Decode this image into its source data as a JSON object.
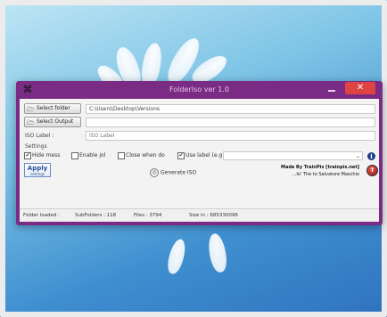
{
  "window": {
    "title": "FolderIso ver 1.0",
    "close_symbol": "✕"
  },
  "buttons": {
    "select_folder": "Select folder",
    "select_output": "Select Output"
  },
  "fields": {
    "folder_path": "C:\\Users\\Desktop\\Versions",
    "output_path": "",
    "iso_label_label": "ISO Label :",
    "iso_label_placeholder": "ISO Label"
  },
  "settings": {
    "heading": "Settings",
    "hide_msg": {
      "label": "Hide mess",
      "checked": true
    },
    "enable_jol": {
      "label": "Enable jol",
      "checked": false
    },
    "close_when_done": {
      "label": "Close when do",
      "checked": false
    },
    "use_label": {
      "label": "Use label (e.g",
      "checked": true
    },
    "label_select_value": ""
  },
  "actions": {
    "apply_label": "Apply",
    "apply_sub": "settings",
    "generate_label": "Generate ISO"
  },
  "credits": {
    "line1": "Made By TrainPix [trainpix.net]",
    "line2": "...Io' The to Salvatore Maschio"
  },
  "status": {
    "folder_loaded": "Folder loaded :",
    "subfolders": "SubFolders : 118",
    "files": "Files : 3794",
    "size": "Size in : 685330096"
  },
  "icons": {
    "app": "app-icon",
    "folder": "folder-icon",
    "info": "info-icon",
    "generate": "disc-icon",
    "logo": "author-logo-icon"
  }
}
